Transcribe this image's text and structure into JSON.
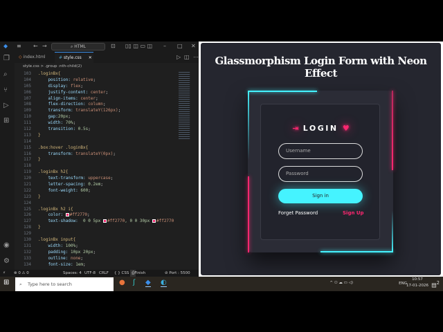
{
  "editor": {
    "command_center": "HTML",
    "tabs": [
      {
        "label": "index.html",
        "active": false
      },
      {
        "label": "style.css",
        "active": true
      }
    ],
    "tab_close": "✕",
    "breadcrumb": {
      "file": "style.css",
      "sep": ">",
      "symbol": ".group :nth-child(2)"
    },
    "code_lines": [
      {
        "n": "103",
        "t": [
          [
            ".loginBx{",
            "sel"
          ]
        ]
      },
      {
        "n": "104",
        "t": [
          [
            "    position: ",
            "prop"
          ],
          [
            "relative",
            "val"
          ],
          [
            ";",
            "pun"
          ]
        ]
      },
      {
        "n": "105",
        "t": [
          [
            "    display: ",
            "prop"
          ],
          [
            "flex",
            "val"
          ],
          [
            ";",
            "pun"
          ]
        ]
      },
      {
        "n": "106",
        "t": [
          [
            "    justify-content: ",
            "prop"
          ],
          [
            "center",
            "val"
          ],
          [
            ";",
            "pun"
          ]
        ]
      },
      {
        "n": "107",
        "t": [
          [
            "    align-items: ",
            "prop"
          ],
          [
            "center",
            "val"
          ],
          [
            ";",
            "pun"
          ]
        ]
      },
      {
        "n": "108",
        "t": [
          [
            "    flex-direction: ",
            "prop"
          ],
          [
            "column",
            "val"
          ],
          [
            ";",
            "pun"
          ]
        ]
      },
      {
        "n": "109",
        "t": [
          [
            "    transform: ",
            "prop"
          ],
          [
            "translateY(126px)",
            "val"
          ],
          [
            ";",
            "pun"
          ]
        ]
      },
      {
        "n": "110",
        "t": [
          [
            "    gap:",
            "prop"
          ],
          [
            "20px",
            "num"
          ],
          [
            ";",
            "pun"
          ]
        ]
      },
      {
        "n": "111",
        "t": [
          [
            "    width: ",
            "prop"
          ],
          [
            "70%",
            "num"
          ],
          [
            ";",
            "pun"
          ]
        ]
      },
      {
        "n": "112",
        "t": [
          [
            "    transition: ",
            "prop"
          ],
          [
            "0.5s",
            "num"
          ],
          [
            ";",
            "pun"
          ]
        ]
      },
      {
        "n": "113",
        "t": [
          [
            "}",
            "sel"
          ]
        ]
      },
      {
        "n": "114",
        "t": []
      },
      {
        "n": "115",
        "t": [
          [
            ".box:hover .loginBx{",
            "sel"
          ]
        ]
      },
      {
        "n": "116",
        "t": [
          [
            "    transform: ",
            "prop"
          ],
          [
            "translateY(0px)",
            "val"
          ],
          [
            ";",
            "pun"
          ]
        ]
      },
      {
        "n": "117",
        "t": [
          [
            "}",
            "sel"
          ]
        ]
      },
      {
        "n": "118",
        "t": []
      },
      {
        "n": "119",
        "t": [
          [
            ".loginBx h2{",
            "sel"
          ]
        ]
      },
      {
        "n": "120",
        "t": [
          [
            "    text-transform: ",
            "prop"
          ],
          [
            "uppercase",
            "val"
          ],
          [
            ";",
            "pun"
          ]
        ]
      },
      {
        "n": "121",
        "t": [
          [
            "    letter-spacing: ",
            "prop"
          ],
          [
            "0.2em",
            "num"
          ],
          [
            ";",
            "pun"
          ]
        ]
      },
      {
        "n": "122",
        "t": [
          [
            "    font-weight: ",
            "prop"
          ],
          [
            "600",
            "num"
          ],
          [
            ";",
            "pun"
          ]
        ]
      },
      {
        "n": "123",
        "t": [
          [
            "}",
            "sel"
          ]
        ]
      },
      {
        "n": "124",
        "t": []
      },
      {
        "n": "125",
        "t": [
          [
            ".loginBx h2 i{",
            "sel"
          ]
        ]
      },
      {
        "n": "126",
        "t": [
          [
            "    color: ",
            "prop"
          ],
          [
            "#SW",
            "sw"
          ],
          [
            "#ff2770",
            "val"
          ],
          [
            ";",
            "pun"
          ]
        ]
      },
      {
        "n": "127",
        "t": [
          [
            "    text-shadow:  ",
            "prop"
          ],
          [
            "0 0 5px ",
            "num"
          ],
          [
            "#SW",
            "sw"
          ],
          [
            "#ff2770",
            "val"
          ],
          [
            ", 0 0 30px ",
            "num"
          ],
          [
            "#SW",
            "sw"
          ],
          [
            "#ff2770",
            "val"
          ]
        ]
      },
      {
        "n": "128",
        "t": [
          [
            "}",
            "sel"
          ]
        ]
      },
      {
        "n": "129",
        "t": []
      },
      {
        "n": "130",
        "t": [
          [
            ".loginBx input{",
            "sel"
          ]
        ]
      },
      {
        "n": "131",
        "t": [
          [
            "    width: ",
            "prop"
          ],
          [
            "100%",
            "num"
          ],
          [
            ";",
            "pun"
          ]
        ]
      },
      {
        "n": "132",
        "t": [
          [
            "    padding: ",
            "prop"
          ],
          [
            "10px 20px",
            "num"
          ],
          [
            ";",
            "pun"
          ]
        ]
      },
      {
        "n": "133",
        "t": [
          [
            "    outline: ",
            "prop"
          ],
          [
            "none",
            "val"
          ],
          [
            ";",
            "pun"
          ]
        ]
      },
      {
        "n": "134",
        "t": [
          [
            "    font-size: ",
            "prop"
          ],
          [
            "1em",
            "num"
          ],
          [
            ";",
            "pun"
          ]
        ]
      }
    ],
    "status": {
      "errors": "⊗ 0 ⚠ 0",
      "spaces": "Spaces: 4",
      "encoding": "UTF-8",
      "eol": "CRLF",
      "language": "{ } CSS",
      "finish_setup": "Finish Setup",
      "port": "⊘ Port : 5500"
    }
  },
  "browser": {
    "heading": "Glassmorphism Login Form with Neon Effect",
    "login_title": "LOGIN",
    "username_placeholder": "Username",
    "password_placeholder": "Password",
    "signin_label": "Sign in",
    "forget_label": "Forget Password",
    "signup_label": "Sign Up",
    "colors": {
      "pink": "#ff2770",
      "cyan": "#45f3ff"
    }
  },
  "taskbar": {
    "search_placeholder": "Type here to search",
    "language": "ENG",
    "time": "10:57",
    "date": "17-01-2026",
    "notification_count": "2"
  }
}
